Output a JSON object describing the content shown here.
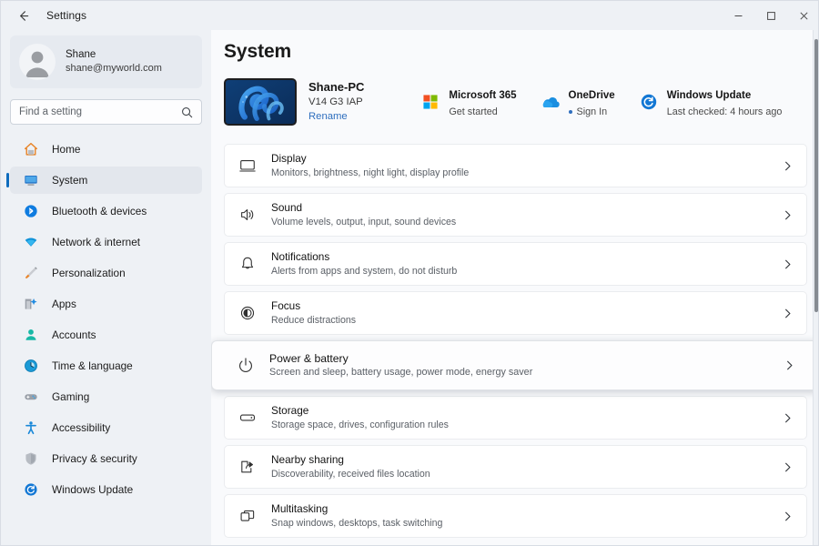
{
  "titlebar": {
    "back_icon": "arrow-left-icon",
    "title": "Settings",
    "minimize_icon": "minimize-icon",
    "maximize_icon": "maximize-icon",
    "close_icon": "close-icon"
  },
  "sidebar": {
    "account": {
      "avatar_icon": "person-avatar-icon",
      "name": "Shane",
      "email": "shane@myworld.com"
    },
    "search": {
      "placeholder": "Find a setting",
      "icon": "search-icon"
    },
    "items": [
      {
        "label": "Home",
        "icon": "home-icon",
        "selected": false
      },
      {
        "label": "System",
        "icon": "system-monitor-icon",
        "selected": true
      },
      {
        "label": "Bluetooth & devices",
        "icon": "bluetooth-icon",
        "selected": false
      },
      {
        "label": "Network & internet",
        "icon": "wifi-icon",
        "selected": false
      },
      {
        "label": "Personalization",
        "icon": "paintbrush-icon",
        "selected": false
      },
      {
        "label": "Apps",
        "icon": "apps-icon",
        "selected": false
      },
      {
        "label": "Accounts",
        "icon": "account-person-icon",
        "selected": false
      },
      {
        "label": "Time & language",
        "icon": "clock-icon",
        "selected": false
      },
      {
        "label": "Gaming",
        "icon": "gamepad-icon",
        "selected": false
      },
      {
        "label": "Accessibility",
        "icon": "accessibility-icon",
        "selected": false
      },
      {
        "label": "Privacy & security",
        "icon": "shield-icon",
        "selected": false
      },
      {
        "label": "Windows Update",
        "icon": "update-refresh-icon",
        "selected": false
      }
    ]
  },
  "main": {
    "page_title": "System",
    "device": {
      "thumbnail_icon": "laptop-wallpaper-thumbnail",
      "name": "Shane-PC",
      "model": "V14 G3 IAP",
      "rename_label": "Rename"
    },
    "statuses": [
      {
        "icon": "microsoft-365-icon",
        "title": "Microsoft 365",
        "subtitle": "Get started",
        "has_dot": false
      },
      {
        "icon": "onedrive-cloud-icon",
        "title": "OneDrive",
        "subtitle": "Sign In",
        "has_dot": true
      },
      {
        "icon": "windows-update-icon",
        "title": "Windows Update",
        "subtitle": "Last checked: 4 hours ago",
        "has_dot": false
      }
    ],
    "settings_rows": [
      {
        "title": "Display",
        "subtitle": "Monitors, brightness, night light, display profile",
        "icon": "monitor-icon",
        "highlighted": false
      },
      {
        "title": "Sound",
        "subtitle": "Volume levels, output, input, sound devices",
        "icon": "speaker-icon",
        "highlighted": false
      },
      {
        "title": "Notifications",
        "subtitle": "Alerts from apps and system, do not disturb",
        "icon": "bell-icon",
        "highlighted": false
      },
      {
        "title": "Focus",
        "subtitle": "Reduce distractions",
        "icon": "focus-icon",
        "highlighted": false
      },
      {
        "title": "Power & battery",
        "subtitle": "Screen and sleep, battery usage, power mode, energy saver",
        "icon": "power-icon",
        "highlighted": true
      },
      {
        "title": "Storage",
        "subtitle": "Storage space, drives, configuration rules",
        "icon": "storage-drive-icon",
        "highlighted": false
      },
      {
        "title": "Nearby sharing",
        "subtitle": "Discoverability, received files location",
        "icon": "nearby-share-icon",
        "highlighted": false
      },
      {
        "title": "Multitasking",
        "subtitle": "Snap windows, desktops, task switching",
        "icon": "multitasking-windows-icon",
        "highlighted": false
      }
    ],
    "chevron_icon": "chevron-right-icon"
  },
  "colors": {
    "accent": "#0f6cbd",
    "link": "#2f6fbe",
    "sidebar_bg": "#eef1f5",
    "content_bg": "#f9fafc",
    "card_bg": "#ffffff"
  }
}
